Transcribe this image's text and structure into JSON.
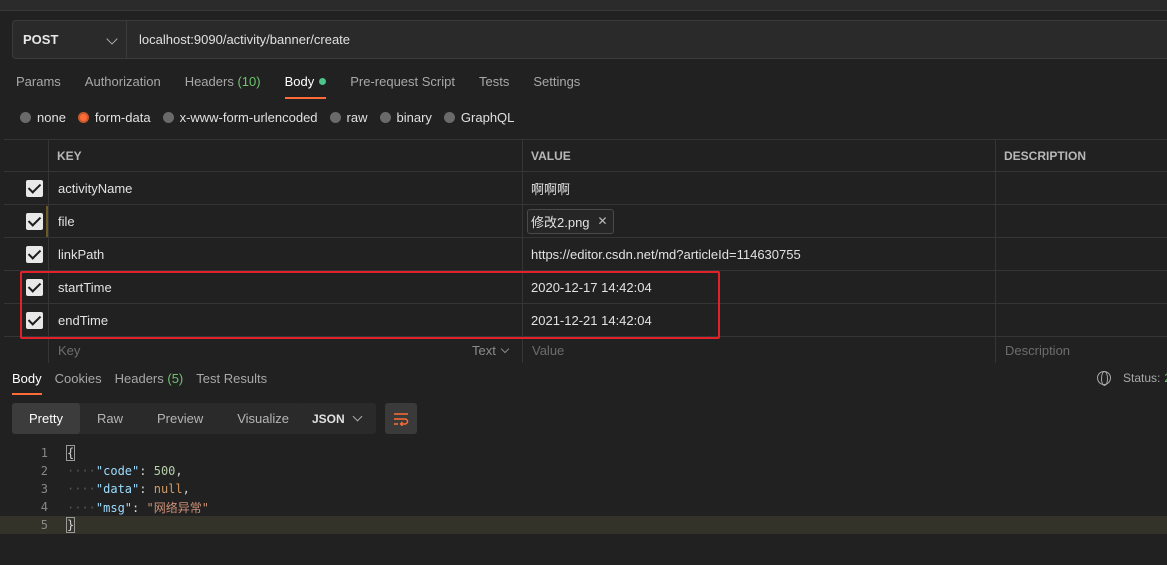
{
  "request": {
    "method": "POST",
    "url": "localhost:9090/activity/banner/create"
  },
  "tabs": [
    {
      "label": "Params"
    },
    {
      "label": "Authorization"
    },
    {
      "label": "Headers",
      "count": "(10)"
    },
    {
      "label": "Body"
    },
    {
      "label": "Pre-request Script"
    },
    {
      "label": "Tests"
    },
    {
      "label": "Settings"
    }
  ],
  "body_types": [
    {
      "label": "none"
    },
    {
      "label": "form-data"
    },
    {
      "label": "x-www-form-urlencoded"
    },
    {
      "label": "raw"
    },
    {
      "label": "binary"
    },
    {
      "label": "GraphQL"
    }
  ],
  "table": {
    "headers": {
      "key": "KEY",
      "value": "VALUE",
      "description": "DESCRIPTION"
    },
    "rows": [
      {
        "key": "activityName",
        "value": "啊啊啊"
      },
      {
        "key": "file",
        "value": "修改2.png"
      },
      {
        "key": "linkPath",
        "value": "https://editor.csdn.net/md?articleId=114630755"
      },
      {
        "key": "startTime",
        "value": "2020-12-17 14:42:04"
      },
      {
        "key": "endTime",
        "value": "2021-12-21 14:42:04"
      }
    ],
    "placeholders": {
      "key": "Key",
      "type": "Text",
      "value": "Value",
      "description": "Description"
    }
  },
  "response": {
    "tabs": [
      {
        "label": "Body"
      },
      {
        "label": "Cookies"
      },
      {
        "label": "Headers",
        "count": "(5)"
      },
      {
        "label": "Test Results"
      }
    ],
    "status_label": "Status:",
    "status_value": "2",
    "views": [
      "Pretty",
      "Raw",
      "Preview",
      "Visualize"
    ],
    "format": "JSON",
    "code": {
      "line_numbers": [
        "1",
        "2",
        "3",
        "4",
        "5"
      ],
      "open_brace": "{",
      "close_brace": "}",
      "entries": [
        {
          "key": "\"code\"",
          "value": "500",
          "sep": ","
        },
        {
          "key": "\"data\"",
          "value": "null",
          "sep": ","
        },
        {
          "key": "\"msg\"",
          "value": "\"网络异常\"",
          "sep": ""
        }
      ]
    }
  }
}
